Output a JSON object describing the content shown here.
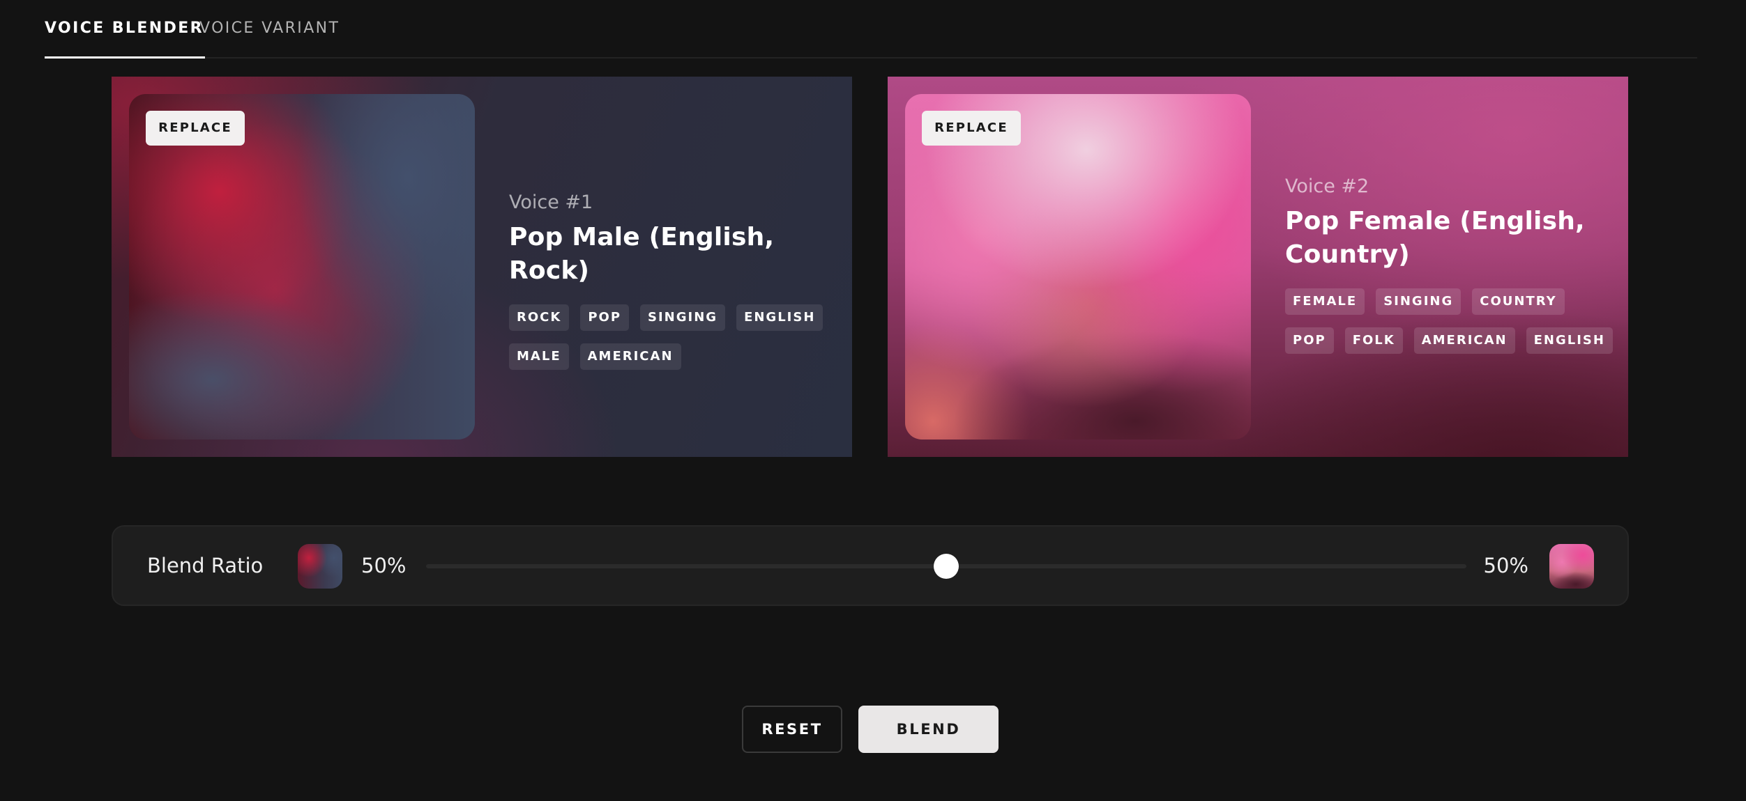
{
  "tabs": [
    {
      "label": "VOICE BLENDER",
      "active": true
    },
    {
      "label": "VOICE VARIANT",
      "active": false
    }
  ],
  "voices": [
    {
      "replace_label": "REPLACE",
      "number": "Voice #1",
      "name": "Pop Male (English, Rock)",
      "tags": [
        "ROCK",
        "POP",
        "SINGING",
        "ENGLISH",
        "MALE",
        "AMERICAN"
      ]
    },
    {
      "replace_label": "REPLACE",
      "number": "Voice #2",
      "name": "Pop Female (English, Country)",
      "tags": [
        "FEMALE",
        "SINGING",
        "COUNTRY",
        "POP",
        "FOLK",
        "AMERICAN",
        "ENGLISH"
      ]
    }
  ],
  "blend": {
    "label": "Blend Ratio",
    "left_percent": "50%",
    "right_percent": "50%",
    "slider_value": 0.5
  },
  "actions": {
    "reset_label": "RESET",
    "blend_label": "BLEND"
  }
}
